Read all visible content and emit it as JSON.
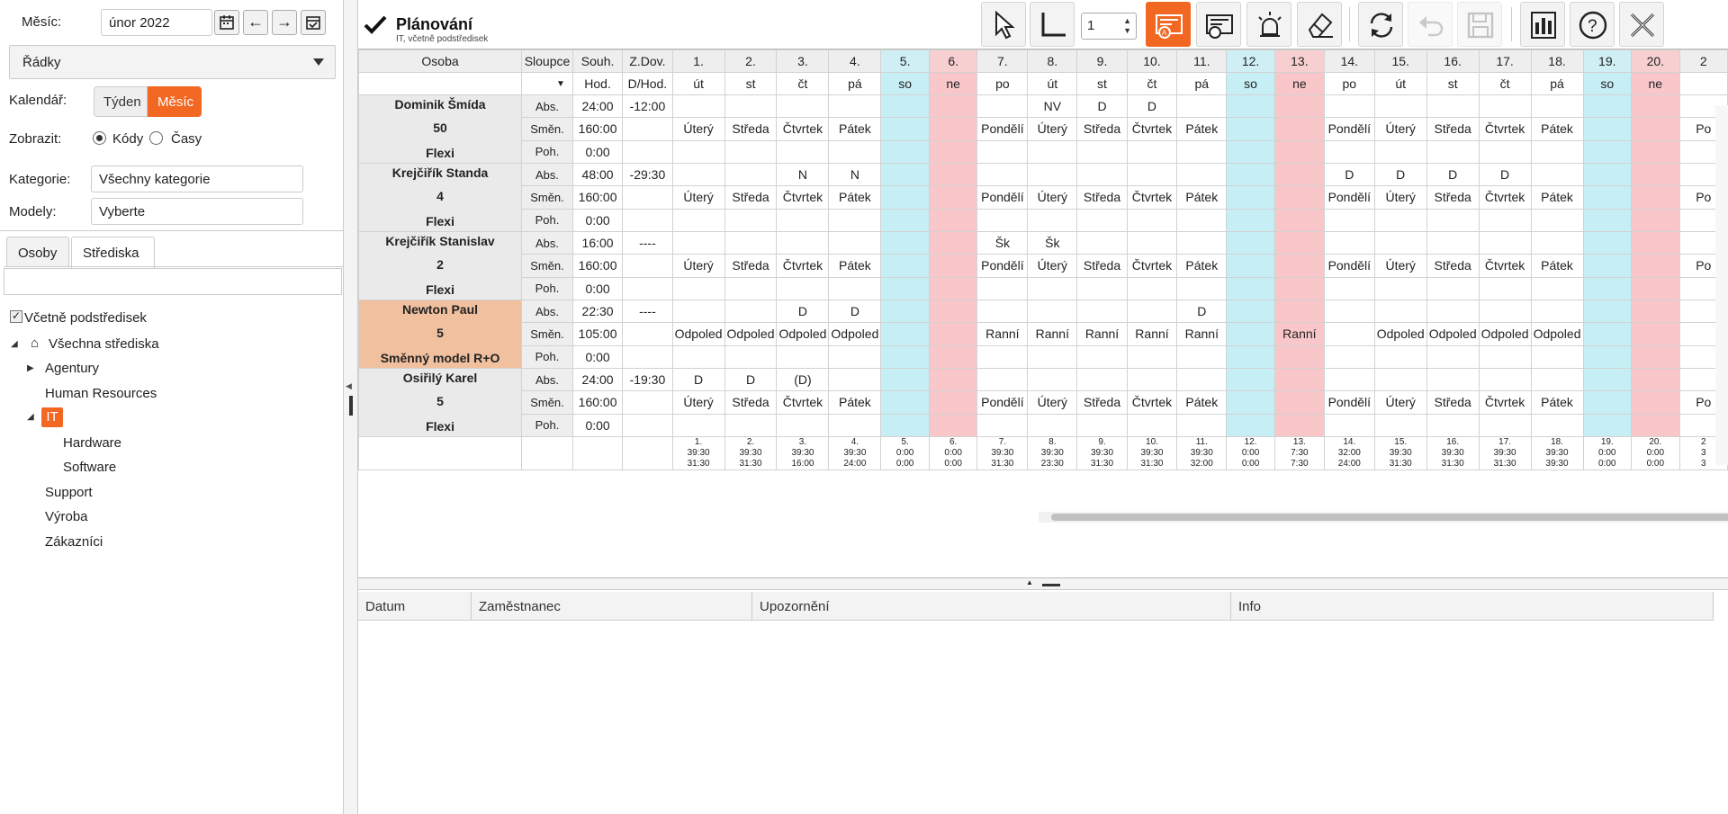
{
  "left": {
    "month_label": "Měsíc:",
    "month_value": "únor 2022",
    "rows_dropdown": "Řádky",
    "calendar_label": "Kalendář:",
    "view_week": "Týden",
    "view_month": "Měsíc",
    "display_label": "Zobrazit:",
    "display_codes": "Kódy",
    "display_times": "Časy",
    "category_label": "Kategorie:",
    "category_value": "Všechny kategorie",
    "models_label": "Modely:",
    "models_value": "Vyberte",
    "tab_persons": "Osoby",
    "tab_centers": "Střediska",
    "include_sub": "Včetně podstředisek",
    "tree": {
      "root": "Všechna střediska",
      "agentury": "Agentury",
      "hr": "Human Resources",
      "it": "IT",
      "hardware": "Hardware",
      "software": "Software",
      "support": "Support",
      "vyroba": "Výroba",
      "zakaznici": "Zákazníci"
    }
  },
  "header": {
    "title": "Plánování",
    "subtitle": "IT, včetně podstředisek",
    "spin_value": "1"
  },
  "grid": {
    "col_osoba": "Osoba",
    "col_sloupce": "Sloupce",
    "col_souh": "Souh.",
    "col_souh_sub": "Hod.",
    "col_zdov": "Z.Dov.",
    "col_zdov_sub": "D/Hod.",
    "row_labels": [
      "Abs.",
      "Směn.",
      "Poh."
    ],
    "days": [
      {
        "n": "1.",
        "d": "út",
        "t": "w"
      },
      {
        "n": "2.",
        "d": "st",
        "t": "w"
      },
      {
        "n": "3.",
        "d": "čt",
        "t": "w"
      },
      {
        "n": "4.",
        "d": "pá",
        "t": "w"
      },
      {
        "n": "5.",
        "d": "so",
        "t": "sat"
      },
      {
        "n": "6.",
        "d": "ne",
        "t": "sun"
      },
      {
        "n": "7.",
        "d": "po",
        "t": "w"
      },
      {
        "n": "8.",
        "d": "út",
        "t": "w"
      },
      {
        "n": "9.",
        "d": "st",
        "t": "w"
      },
      {
        "n": "10.",
        "d": "čt",
        "t": "w"
      },
      {
        "n": "11.",
        "d": "pá",
        "t": "w"
      },
      {
        "n": "12.",
        "d": "so",
        "t": "sat"
      },
      {
        "n": "13.",
        "d": "ne",
        "t": "sun"
      },
      {
        "n": "14.",
        "d": "po",
        "t": "w"
      },
      {
        "n": "15.",
        "d": "út",
        "t": "w"
      },
      {
        "n": "16.",
        "d": "st",
        "t": "w"
      },
      {
        "n": "17.",
        "d": "čt",
        "t": "w"
      },
      {
        "n": "18.",
        "d": "pá",
        "t": "w"
      },
      {
        "n": "19.",
        "d": "so",
        "t": "sat"
      },
      {
        "n": "20.",
        "d": "ne",
        "t": "sun"
      },
      {
        "n": "2",
        "d": "",
        "t": "w"
      }
    ],
    "employees": [
      {
        "name": "Dominik Šmída",
        "ver": "50",
        "model": "Flexi",
        "orange": false,
        "abs": {
          "souh": "24:00",
          "zdov": "-12:00",
          "cells": [
            "",
            "",
            "",
            "",
            "",
            "",
            "",
            "NV",
            "D",
            "D",
            "",
            "",
            "",
            "",
            "",
            "",
            "",
            "",
            "",
            "",
            ""
          ]
        },
        "shift": {
          "souh": "160:00",
          "zdov": "",
          "cells": [
            "Úterý",
            "Středa",
            "Čtvrtek",
            "Pátek",
            "",
            "",
            "Pondělí",
            "Úterý",
            "Středa",
            "Čtvrtek",
            "Pátek",
            "",
            "",
            "Pondělí",
            "Úterý",
            "Středa",
            "Čtvrtek",
            "Pátek",
            "",
            "",
            "Po"
          ]
        },
        "move": {
          "souh": "0:00",
          "zdov": ""
        }
      },
      {
        "name": "Krejčiřík Standa",
        "ver": "4",
        "model": "Flexi",
        "orange": false,
        "abs": {
          "souh": "48:00",
          "zdov": "-29:30",
          "cells": [
            "",
            "",
            "N",
            "N",
            "",
            "",
            "",
            "",
            "",
            "",
            "",
            "",
            "",
            "D",
            "D",
            "D",
            "D",
            "",
            "",
            "",
            ""
          ]
        },
        "shift": {
          "souh": "160:00",
          "zdov": "",
          "cells": [
            "Úterý",
            "Středa",
            "Čtvrtek",
            "Pátek",
            "",
            "",
            "Pondělí",
            "Úterý",
            "Středa",
            "Čtvrtek",
            "Pátek",
            "",
            "",
            "Pondělí",
            "Úterý",
            "Středa",
            "Čtvrtek",
            "Pátek",
            "",
            "",
            "Po"
          ]
        },
        "move": {
          "souh": "0:00",
          "zdov": ""
        }
      },
      {
        "name": "Krejčiřík Stanislav",
        "ver": "2",
        "model": "Flexi",
        "orange": false,
        "abs": {
          "souh": "16:00",
          "zdov": "----",
          "cells": [
            "",
            "",
            "",
            "",
            "",
            "",
            "Šk",
            "Šk",
            "",
            "",
            "",
            "",
            "",
            "",
            "",
            "",
            "",
            "",
            "",
            "",
            ""
          ]
        },
        "shift": {
          "souh": "160:00",
          "zdov": "",
          "cells": [
            "Úterý",
            "Středa",
            "Čtvrtek",
            "Pátek",
            "",
            "",
            "Pondělí",
            "Úterý",
            "Středa",
            "Čtvrtek",
            "Pátek",
            "",
            "",
            "Pondělí",
            "Úterý",
            "Středa",
            "Čtvrtek",
            "Pátek",
            "",
            "",
            "Po"
          ]
        },
        "move": {
          "souh": "0:00",
          "zdov": ""
        }
      },
      {
        "name": "Newton Paul",
        "ver": "5",
        "model": "Směnný model R+O",
        "orange": true,
        "abs": {
          "souh": "22:30",
          "zdov": "----",
          "cells": [
            "",
            "",
            "D",
            "D",
            "",
            "",
            "",
            "",
            "",
            "",
            "D",
            "",
            "",
            "",
            "",
            "",
            "",
            "",
            "",
            "",
            ""
          ]
        },
        "shift": {
          "souh": "105:00",
          "zdov": "",
          "red": true,
          "cells": [
            "Odpoled",
            "Odpoled",
            "Odpoled",
            "Odpoled",
            "",
            "",
            "Ranní",
            "Ranní",
            "Ranní",
            "Ranní",
            "Ranní",
            "",
            "Ranní",
            "",
            "Odpoled",
            "Odpoled",
            "Odpoled",
            "Odpoled",
            "",
            "",
            ""
          ]
        },
        "move": {
          "souh": "0:00",
          "zdov": ""
        }
      },
      {
        "name": "Osiřilý Karel",
        "ver": "5",
        "model": "Flexi",
        "orange": false,
        "abs": {
          "souh": "24:00",
          "zdov": "-19:30",
          "cells": [
            "D",
            "D",
            "(D)",
            "",
            "",
            "",
            "",
            "",
            "",
            "",
            "",
            "",
            "",
            "",
            "",
            "",
            "",
            "",
            "",
            "",
            ""
          ]
        },
        "shift": {
          "souh": "160:00",
          "zdov": "",
          "cells": [
            "Úterý",
            "Středa",
            "Čtvrtek",
            "Pátek",
            "",
            "",
            "Pondělí",
            "Úterý",
            "Středa",
            "Čtvrtek",
            "Pátek",
            "",
            "",
            "Pondělí",
            "Úterý",
            "Středa",
            "Čtvrtek",
            "Pátek",
            "",
            "",
            "Po"
          ]
        },
        "move": {
          "souh": "0:00",
          "zdov": ""
        }
      }
    ],
    "summary": [
      [
        "1.",
        "39:30",
        "31:30"
      ],
      [
        "2.",
        "39:30",
        "31:30"
      ],
      [
        "3.",
        "39:30",
        "16:00"
      ],
      [
        "4.",
        "39:30",
        "24:00"
      ],
      [
        "5.",
        "0:00",
        "0:00"
      ],
      [
        "6.",
        "0:00",
        "0:00"
      ],
      [
        "7.",
        "39:30",
        "31:30"
      ],
      [
        "8.",
        "39:30",
        "23:30"
      ],
      [
        "9.",
        "39:30",
        "31:30"
      ],
      [
        "10.",
        "39:30",
        "31:30"
      ],
      [
        "11.",
        "39:30",
        "32:00"
      ],
      [
        "12.",
        "0:00",
        "0:00"
      ],
      [
        "13.",
        "7:30",
        "7:30"
      ],
      [
        "14.",
        "32:00",
        "24:00"
      ],
      [
        "15.",
        "39:30",
        "31:30"
      ],
      [
        "16.",
        "39:30",
        "31:30"
      ],
      [
        "17.",
        "39:30",
        "31:30"
      ],
      [
        "18.",
        "39:30",
        "39:30"
      ],
      [
        "19.",
        "0:00",
        "0:00"
      ],
      [
        "20.",
        "0:00",
        "0:00"
      ],
      [
        "2",
        "3",
        "3"
      ]
    ]
  },
  "alerts": {
    "col_date": "Datum",
    "col_employee": "Zaměstnanec",
    "col_warning": "Upozornění",
    "col_info": "Info"
  },
  "colors": {
    "accent": "#f26722",
    "saturday": "#c6eff5",
    "sunday": "#f9c7ca",
    "employee_highlight": "#f1c09f",
    "shift_red": "#e21b1b"
  }
}
